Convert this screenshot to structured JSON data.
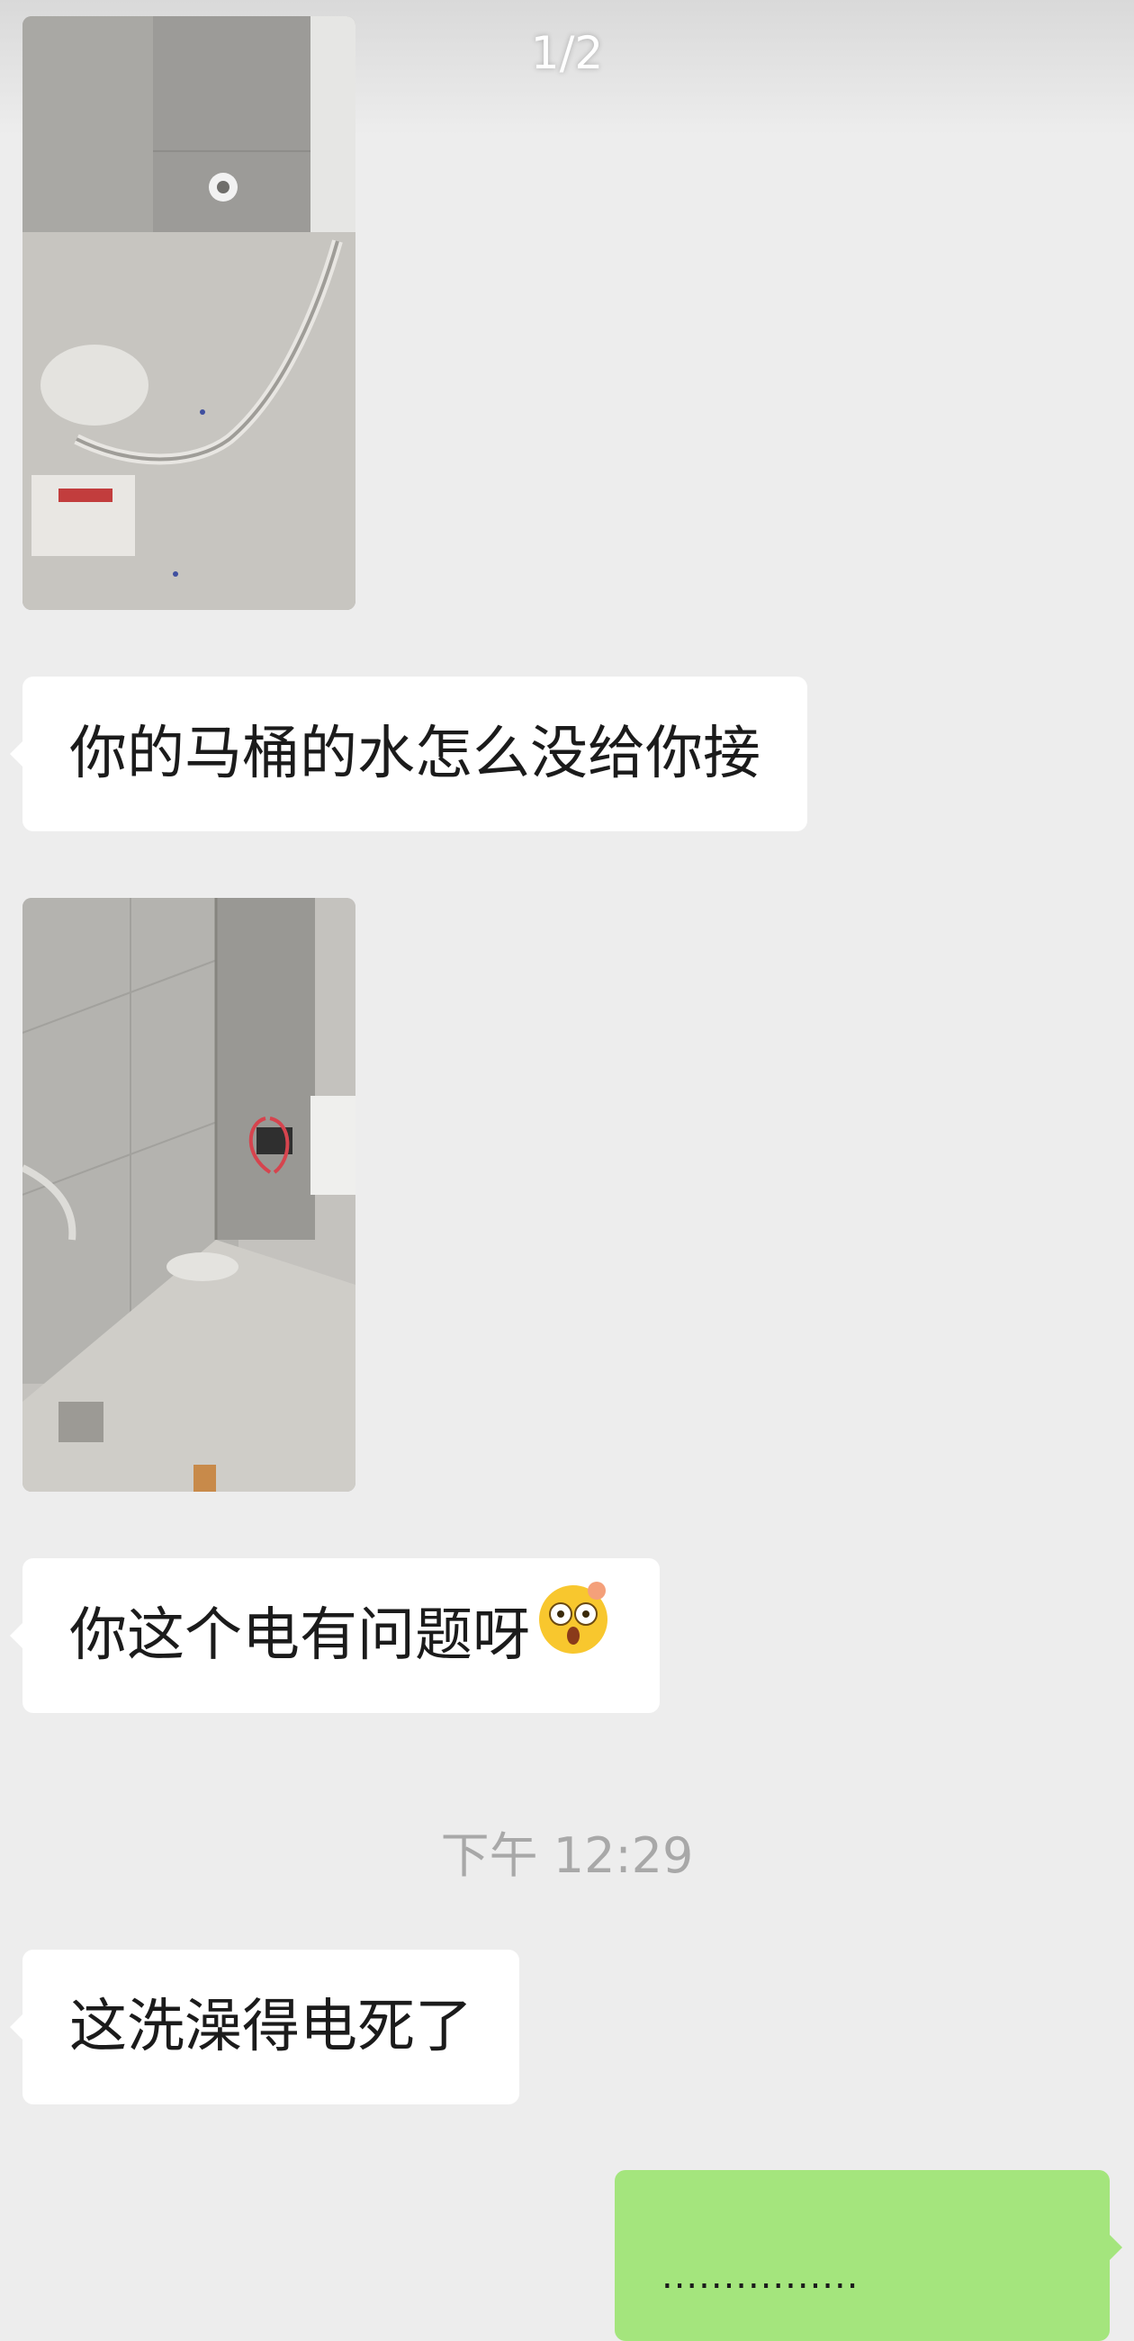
{
  "viewer": {
    "page_counter": "1/2"
  },
  "messages": [
    {
      "type": "image"
    },
    {
      "type": "text",
      "text": "你的马桶的水怎么没给你接"
    },
    {
      "type": "image"
    },
    {
      "type": "text",
      "text": "你这个电有问题呀",
      "emoji": "astonished-face-emoji"
    },
    {
      "type": "timestamp",
      "text": "下午 12:29"
    },
    {
      "type": "text",
      "text": "这洗澡得电死了"
    },
    {
      "type": "text_sent",
      "text": "................"
    }
  ],
  "colors": {
    "background": "#ededed",
    "received_bubble": "#ffffff",
    "sent_bubble": "#a4e57d",
    "timestamp": "#a8a8a8"
  }
}
